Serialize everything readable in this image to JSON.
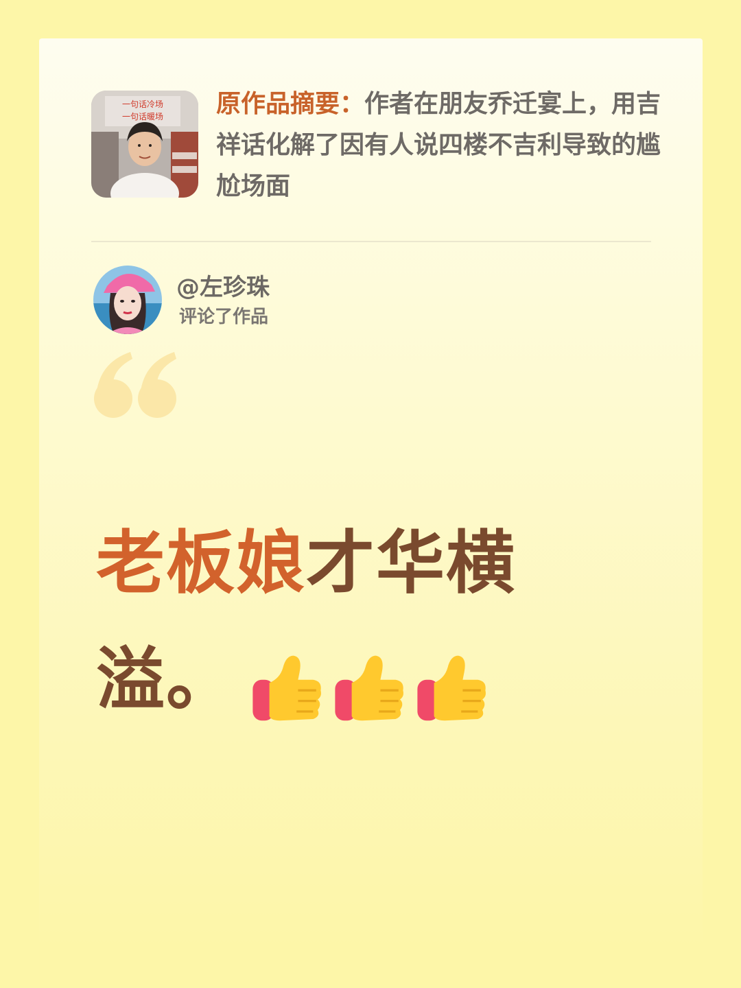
{
  "summary": {
    "label": "原作品摘要：",
    "text": "作者在朋友乔迁宴上，用吉祥话化解了因有人说四楼不吉利导致的尴尬场面"
  },
  "thumbnail": {
    "sign_text_line1": "一句话冷场",
    "sign_text_line2": "一句话暖场"
  },
  "commenter": {
    "name": "@左珍珠",
    "action": "评论了作品"
  },
  "comment": {
    "highlight": "老板娘",
    "rest": "才华横溢。",
    "emoji_icons": [
      "thumbs-up-icon",
      "thumbs-up-icon",
      "thumbs-up-icon"
    ]
  },
  "colors": {
    "background": "#fdf6a8",
    "accent_orange": "#d2622c",
    "comment_brown": "#7a4a2e",
    "label_orange": "#c8622a"
  }
}
